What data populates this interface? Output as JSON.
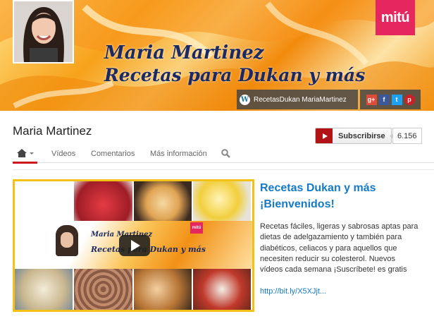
{
  "banner": {
    "brand_logo": "mitú",
    "title": "Maria Martinez",
    "subtitle": "Recetas para Dukan y más",
    "blog_link_icon": "wordpress-icon",
    "blog_link": "RecetasDukan MariaMartinez",
    "social_icons": [
      "google-plus-icon",
      "facebook-icon",
      "twitter-icon",
      "pinterest-icon"
    ],
    "social_glyphs": {
      "google_plus": "g+",
      "facebook": "f",
      "twitter": "t",
      "pinterest": "p"
    }
  },
  "channel": {
    "name": "Maria Martinez",
    "subscribe_label": "Subscribirse",
    "subscriber_count": "6.156"
  },
  "tabs": [
    {
      "label": "",
      "icon": "home-icon",
      "active": true
    },
    {
      "label": "Vídeos"
    },
    {
      "label": "Comentarios"
    },
    {
      "label": "Más información"
    },
    {
      "label": "",
      "icon": "search-icon"
    }
  ],
  "featured": {
    "thumbnail_title": "Maria Martinez",
    "thumbnail_subtitle": "Recetas para Dukan y más",
    "thumbnail_brand": "mitú",
    "title_line1": "Recetas Dukan y más",
    "title_line2": "¡Bienvenidos!",
    "description": "Recetas fáciles, ligeras y sabrosas aptas para dietas de adelgazamiento y también para diabéticos, celiacos y para aquellos que necesiten reducir su colesterol. Nuevos vídeos cada semana ¡Suscríbete! es gratis",
    "link": "http://bit.ly/X5XJjt..."
  },
  "colors": {
    "accent_red": "#cc181e",
    "link_blue": "#167ac6",
    "brand_pink": "#e5265f",
    "highlight_yellow": "#f2c217",
    "banner_text": "#1b2a62"
  }
}
